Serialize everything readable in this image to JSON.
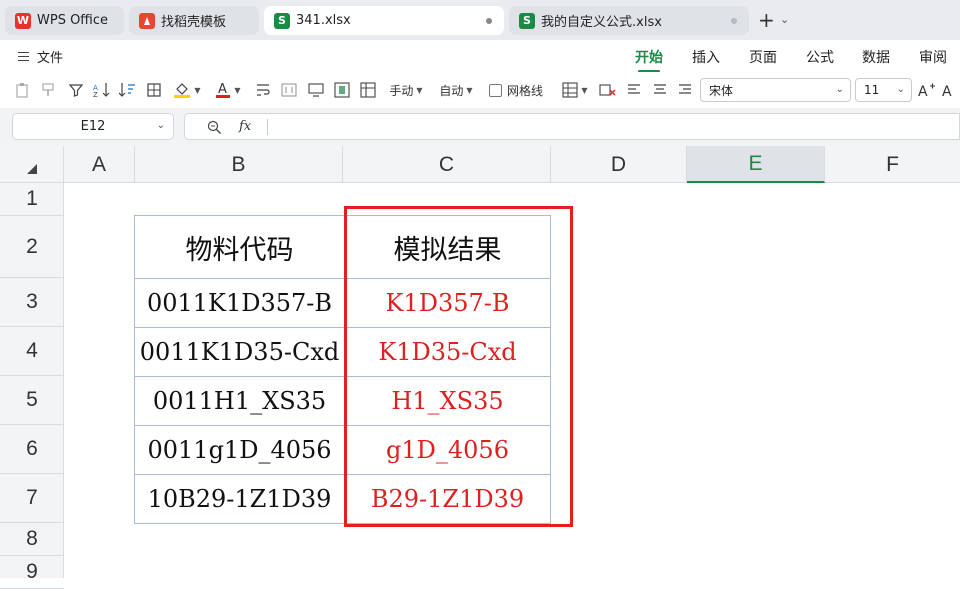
{
  "tabs": [
    {
      "label": "WPS Office",
      "icon": "wps-logo-icon"
    },
    {
      "label": "找稻壳模板",
      "icon": "docer-icon"
    },
    {
      "label": "341.xlsx",
      "icon": "spreadsheet-icon",
      "icon_text": "S"
    },
    {
      "label": "我的自定义公式.xlsx",
      "icon": "spreadsheet-icon",
      "icon_text": "S"
    }
  ],
  "menu": {
    "file_label": "文件",
    "ribbon_tabs": [
      "开始",
      "插入",
      "页面",
      "公式",
      "数据",
      "审阅"
    ]
  },
  "toolbar": {
    "row_height_label": "手动",
    "col_width_label": "自动",
    "gridlines_label": "网格线",
    "font_name": "宋体",
    "font_size": "11",
    "colors": {
      "highlight": "#f7d300",
      "font_color": "#e02020"
    }
  },
  "formula_bar": {
    "cell_ref": "E12",
    "fx_label": "fx",
    "formula": ""
  },
  "sheet": {
    "columns": [
      "A",
      "B",
      "C",
      "D",
      "E",
      "F"
    ],
    "selected_column": "E",
    "rows": [
      "1",
      "2",
      "3",
      "4",
      "5",
      "6",
      "7",
      "8",
      "9"
    ],
    "headers": [
      "物料代码",
      "模拟结果"
    ],
    "data": [
      {
        "code": "0011K1D357-B",
        "result": "K1D357-B"
      },
      {
        "code": "0011K1D35-Cxd",
        "result": "K1D35-Cxd"
      },
      {
        "code": "0011H1_XS35",
        "result": "H1_XS35"
      },
      {
        "code": "0011g1D_4056",
        "result": "g1D_4056"
      },
      {
        "code": "10B29-1Z1D39",
        "result": "B29-1Z1D39"
      }
    ]
  },
  "colors": {
    "accent": "#1b8a45",
    "result_text": "#e02020",
    "highlight_box": "#e61e1e"
  }
}
